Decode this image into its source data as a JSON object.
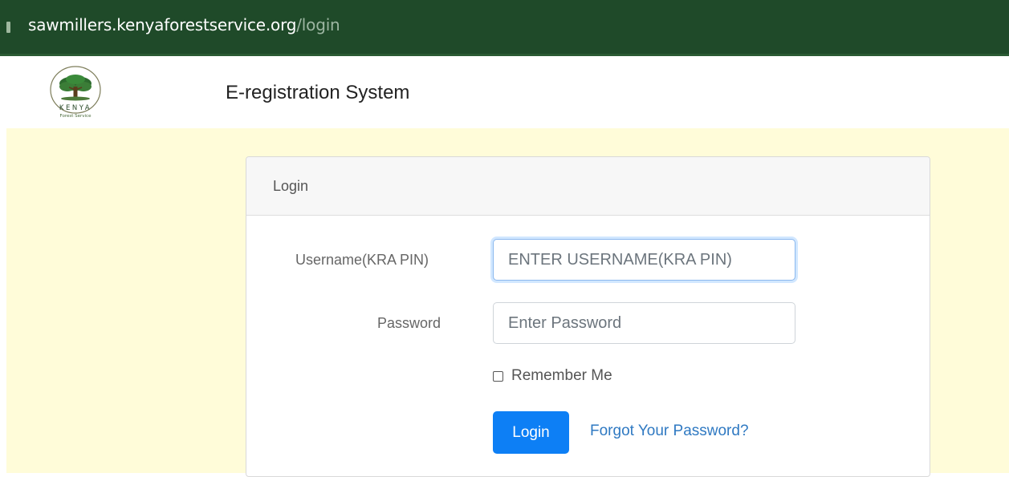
{
  "browser": {
    "url_host": "sawmillers.kenyaforestservice.org",
    "url_path": "/login"
  },
  "header": {
    "logo_text_top": "KENYA",
    "logo_text_bottom": "Forest Service",
    "title": "E-registration System"
  },
  "login_card": {
    "title": "Login",
    "username": {
      "label": "Username(KRA PIN)",
      "placeholder": "ENTER USERNAME(KRA PIN)",
      "value": ""
    },
    "password": {
      "label": "Password",
      "placeholder": "Enter Password",
      "value": ""
    },
    "remember_label": "Remember Me",
    "remember_checked": false,
    "login_button": "Login",
    "forgot_link": "Forgot Your Password?"
  },
  "colors": {
    "address_bar": "#1f4a29",
    "page_background": "#fffcd9",
    "primary_button": "#0d7ff5",
    "link": "#2f79c2"
  },
  "icons": {
    "logo": "kenya-forest-service-tree-logo",
    "checkbox": "checkbox-unchecked-icon"
  }
}
